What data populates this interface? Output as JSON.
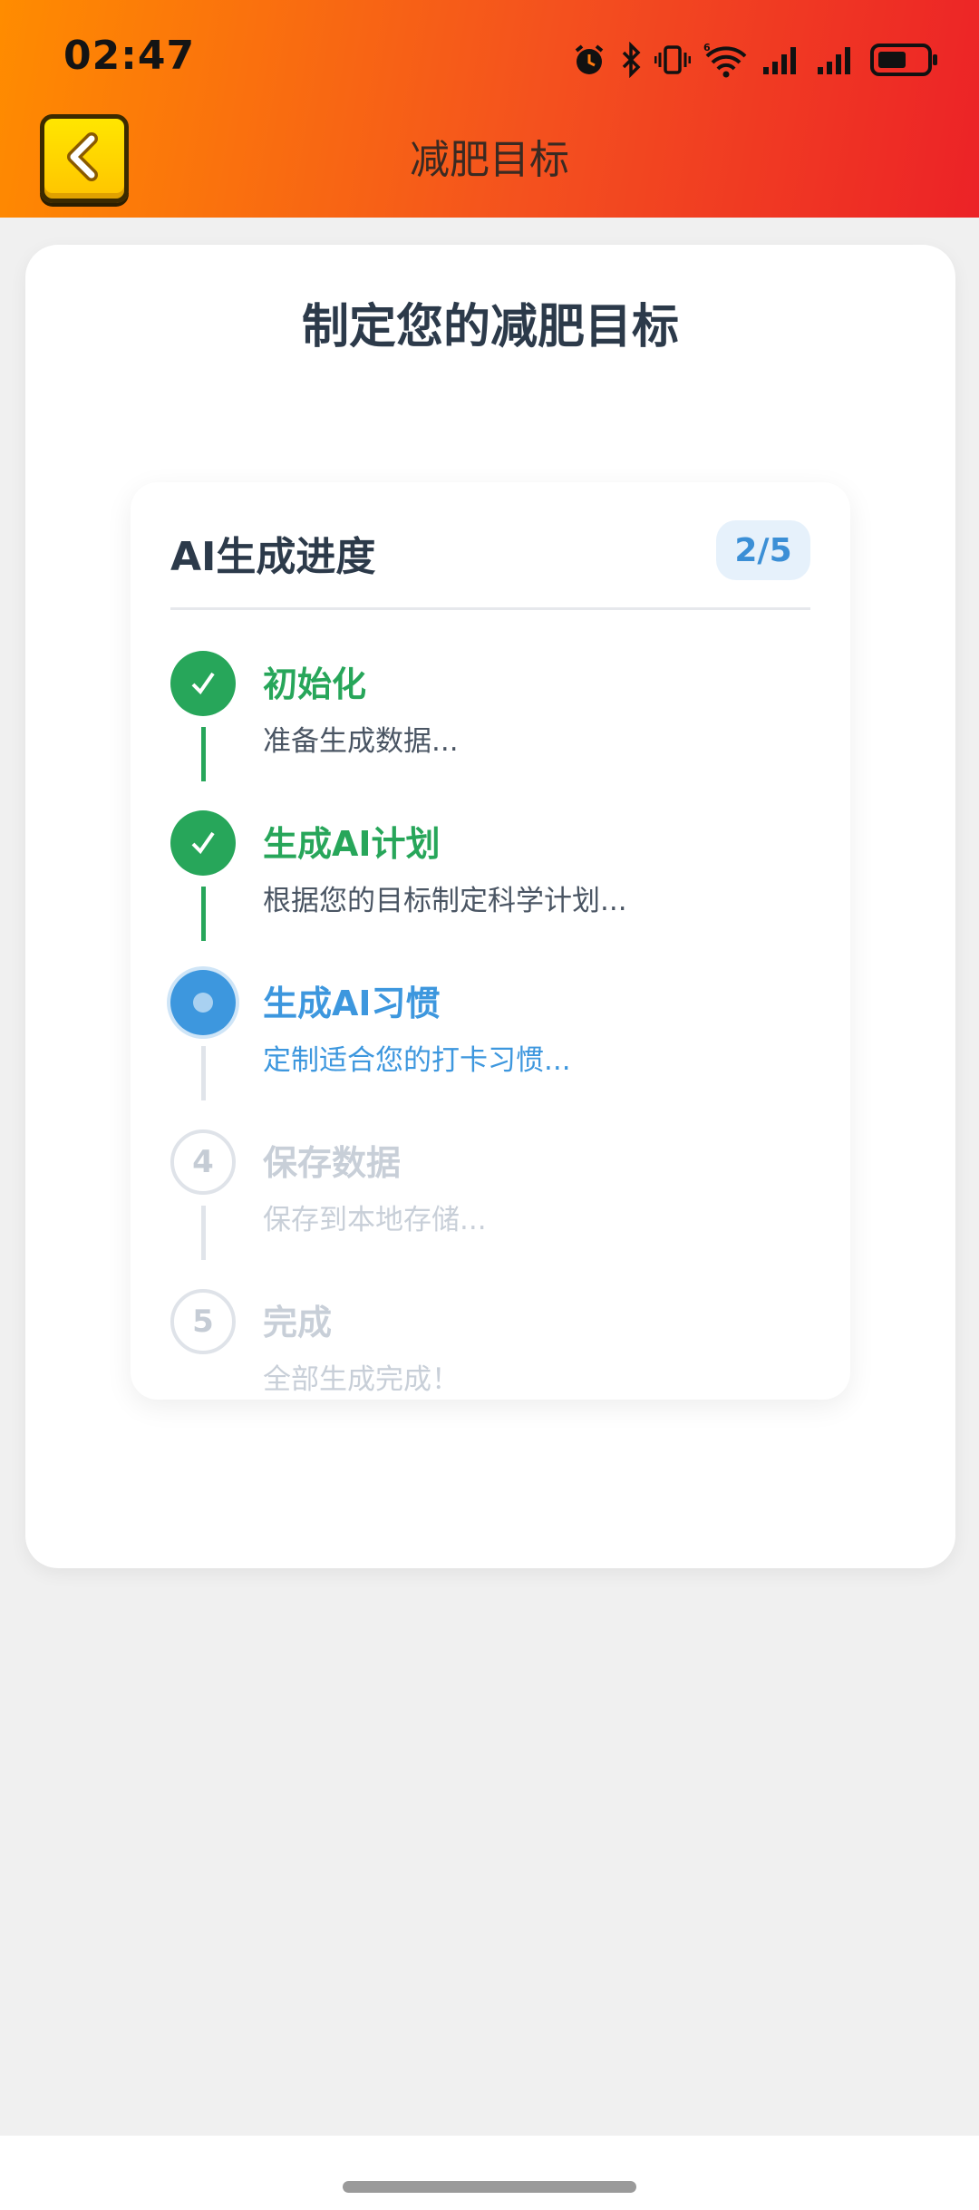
{
  "status_bar": {
    "time": "02:47",
    "icons": [
      "alarm-icon",
      "bluetooth-icon",
      "vibrate-icon",
      "wifi-icon",
      "signal-icon",
      "signal-icon",
      "battery-icon"
    ]
  },
  "nav": {
    "back_icon": "chevron-left-icon",
    "title": "减肥目标"
  },
  "page": {
    "heading": "制定您的减肥目标"
  },
  "progress": {
    "title": "AI生成进度",
    "counter": "2/5",
    "steps": [
      {
        "number": "1",
        "label": "初始化",
        "description": "准备生成数据...",
        "state": "done"
      },
      {
        "number": "2",
        "label": "生成AI计划",
        "description": "根据您的目标制定科学计划...",
        "state": "done"
      },
      {
        "number": "3",
        "label": "生成AI习惯",
        "description": "定制适合您的打卡习惯...",
        "state": "active"
      },
      {
        "number": "4",
        "label": "保存数据",
        "description": "保存到本地存储...",
        "state": "pending"
      },
      {
        "number": "5",
        "label": "完成",
        "description": "全部生成完成！",
        "state": "pending"
      }
    ]
  },
  "colors": {
    "header_gradient_start": "#ff8c00",
    "header_gradient_end": "#ec2227",
    "done": "#27a65a",
    "active": "#3d97de",
    "pending": "#c8cfd8",
    "back_button": "#ffd200"
  }
}
